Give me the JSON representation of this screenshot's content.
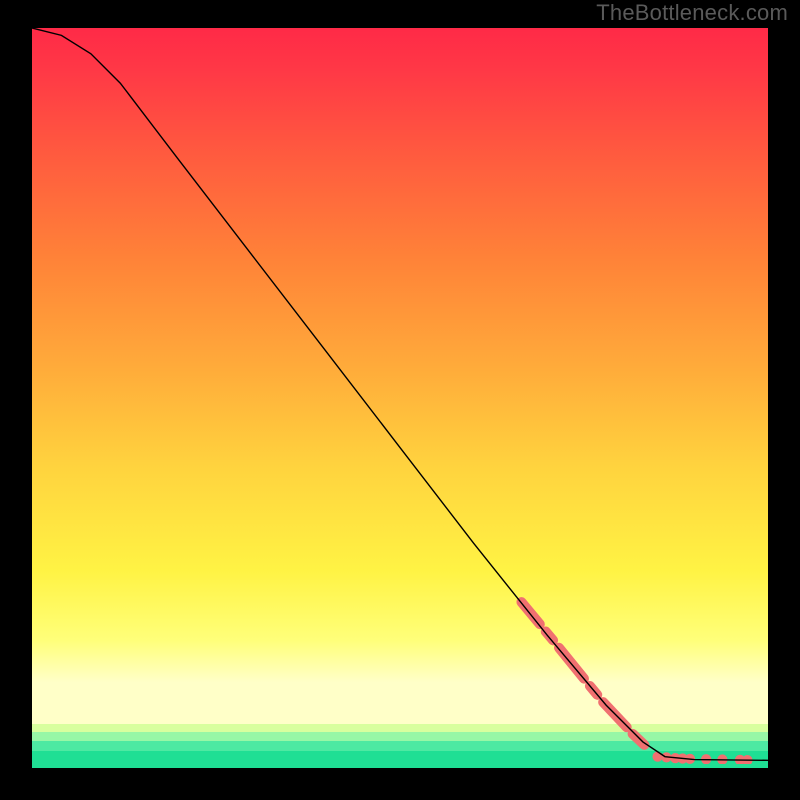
{
  "watermark": "TheBottleneck.com",
  "chart_data": {
    "type": "line",
    "title": "",
    "xlabel": "",
    "ylabel": "",
    "xlim": [
      0,
      100
    ],
    "ylim": [
      0,
      100
    ],
    "curve": [
      {
        "x": 0,
        "y": 100
      },
      {
        "x": 4,
        "y": 99
      },
      {
        "x": 8,
        "y": 96.5
      },
      {
        "x": 12,
        "y": 92.5
      },
      {
        "x": 20,
        "y": 82
      },
      {
        "x": 30,
        "y": 69
      },
      {
        "x": 40,
        "y": 56
      },
      {
        "x": 50,
        "y": 43
      },
      {
        "x": 60,
        "y": 30
      },
      {
        "x": 70,
        "y": 17.5
      },
      {
        "x": 78,
        "y": 8
      },
      {
        "x": 83,
        "y": 3
      },
      {
        "x": 86,
        "y": 1
      },
      {
        "x": 90,
        "y": 0.6
      },
      {
        "x": 100,
        "y": 0.5
      }
    ],
    "marker_segments": [
      {
        "x1": 66.5,
        "y1": 22.0,
        "x2": 69.0,
        "y2": 19.0
      },
      {
        "x1": 69.8,
        "y1": 18.0,
        "x2": 70.8,
        "y2": 16.8
      },
      {
        "x1": 71.6,
        "y1": 15.8,
        "x2": 75.0,
        "y2": 11.6
      },
      {
        "x1": 75.8,
        "y1": 10.6,
        "x2": 76.8,
        "y2": 9.4
      },
      {
        "x1": 77.6,
        "y1": 8.4,
        "x2": 80.8,
        "y2": 5.0
      },
      {
        "x1": 81.6,
        "y1": 4.1,
        "x2": 83.2,
        "y2": 2.6
      }
    ],
    "marker_points": [
      {
        "x": 85.0,
        "y": 1.0
      },
      {
        "x": 86.2,
        "y": 0.9
      },
      {
        "x": 87.4,
        "y": 0.8
      },
      {
        "x": 88.4,
        "y": 0.75
      },
      {
        "x": 89.4,
        "y": 0.7
      },
      {
        "x": 91.6,
        "y": 0.65
      },
      {
        "x": 93.8,
        "y": 0.6
      },
      {
        "x": 96.2,
        "y": 0.55
      },
      {
        "x": 97.2,
        "y": 0.52
      }
    ],
    "colors": {
      "curve": "#000000",
      "marker": "#f07070",
      "gradient_top": "#ff2a47",
      "gradient_bottom": "#1fdf94"
    }
  }
}
